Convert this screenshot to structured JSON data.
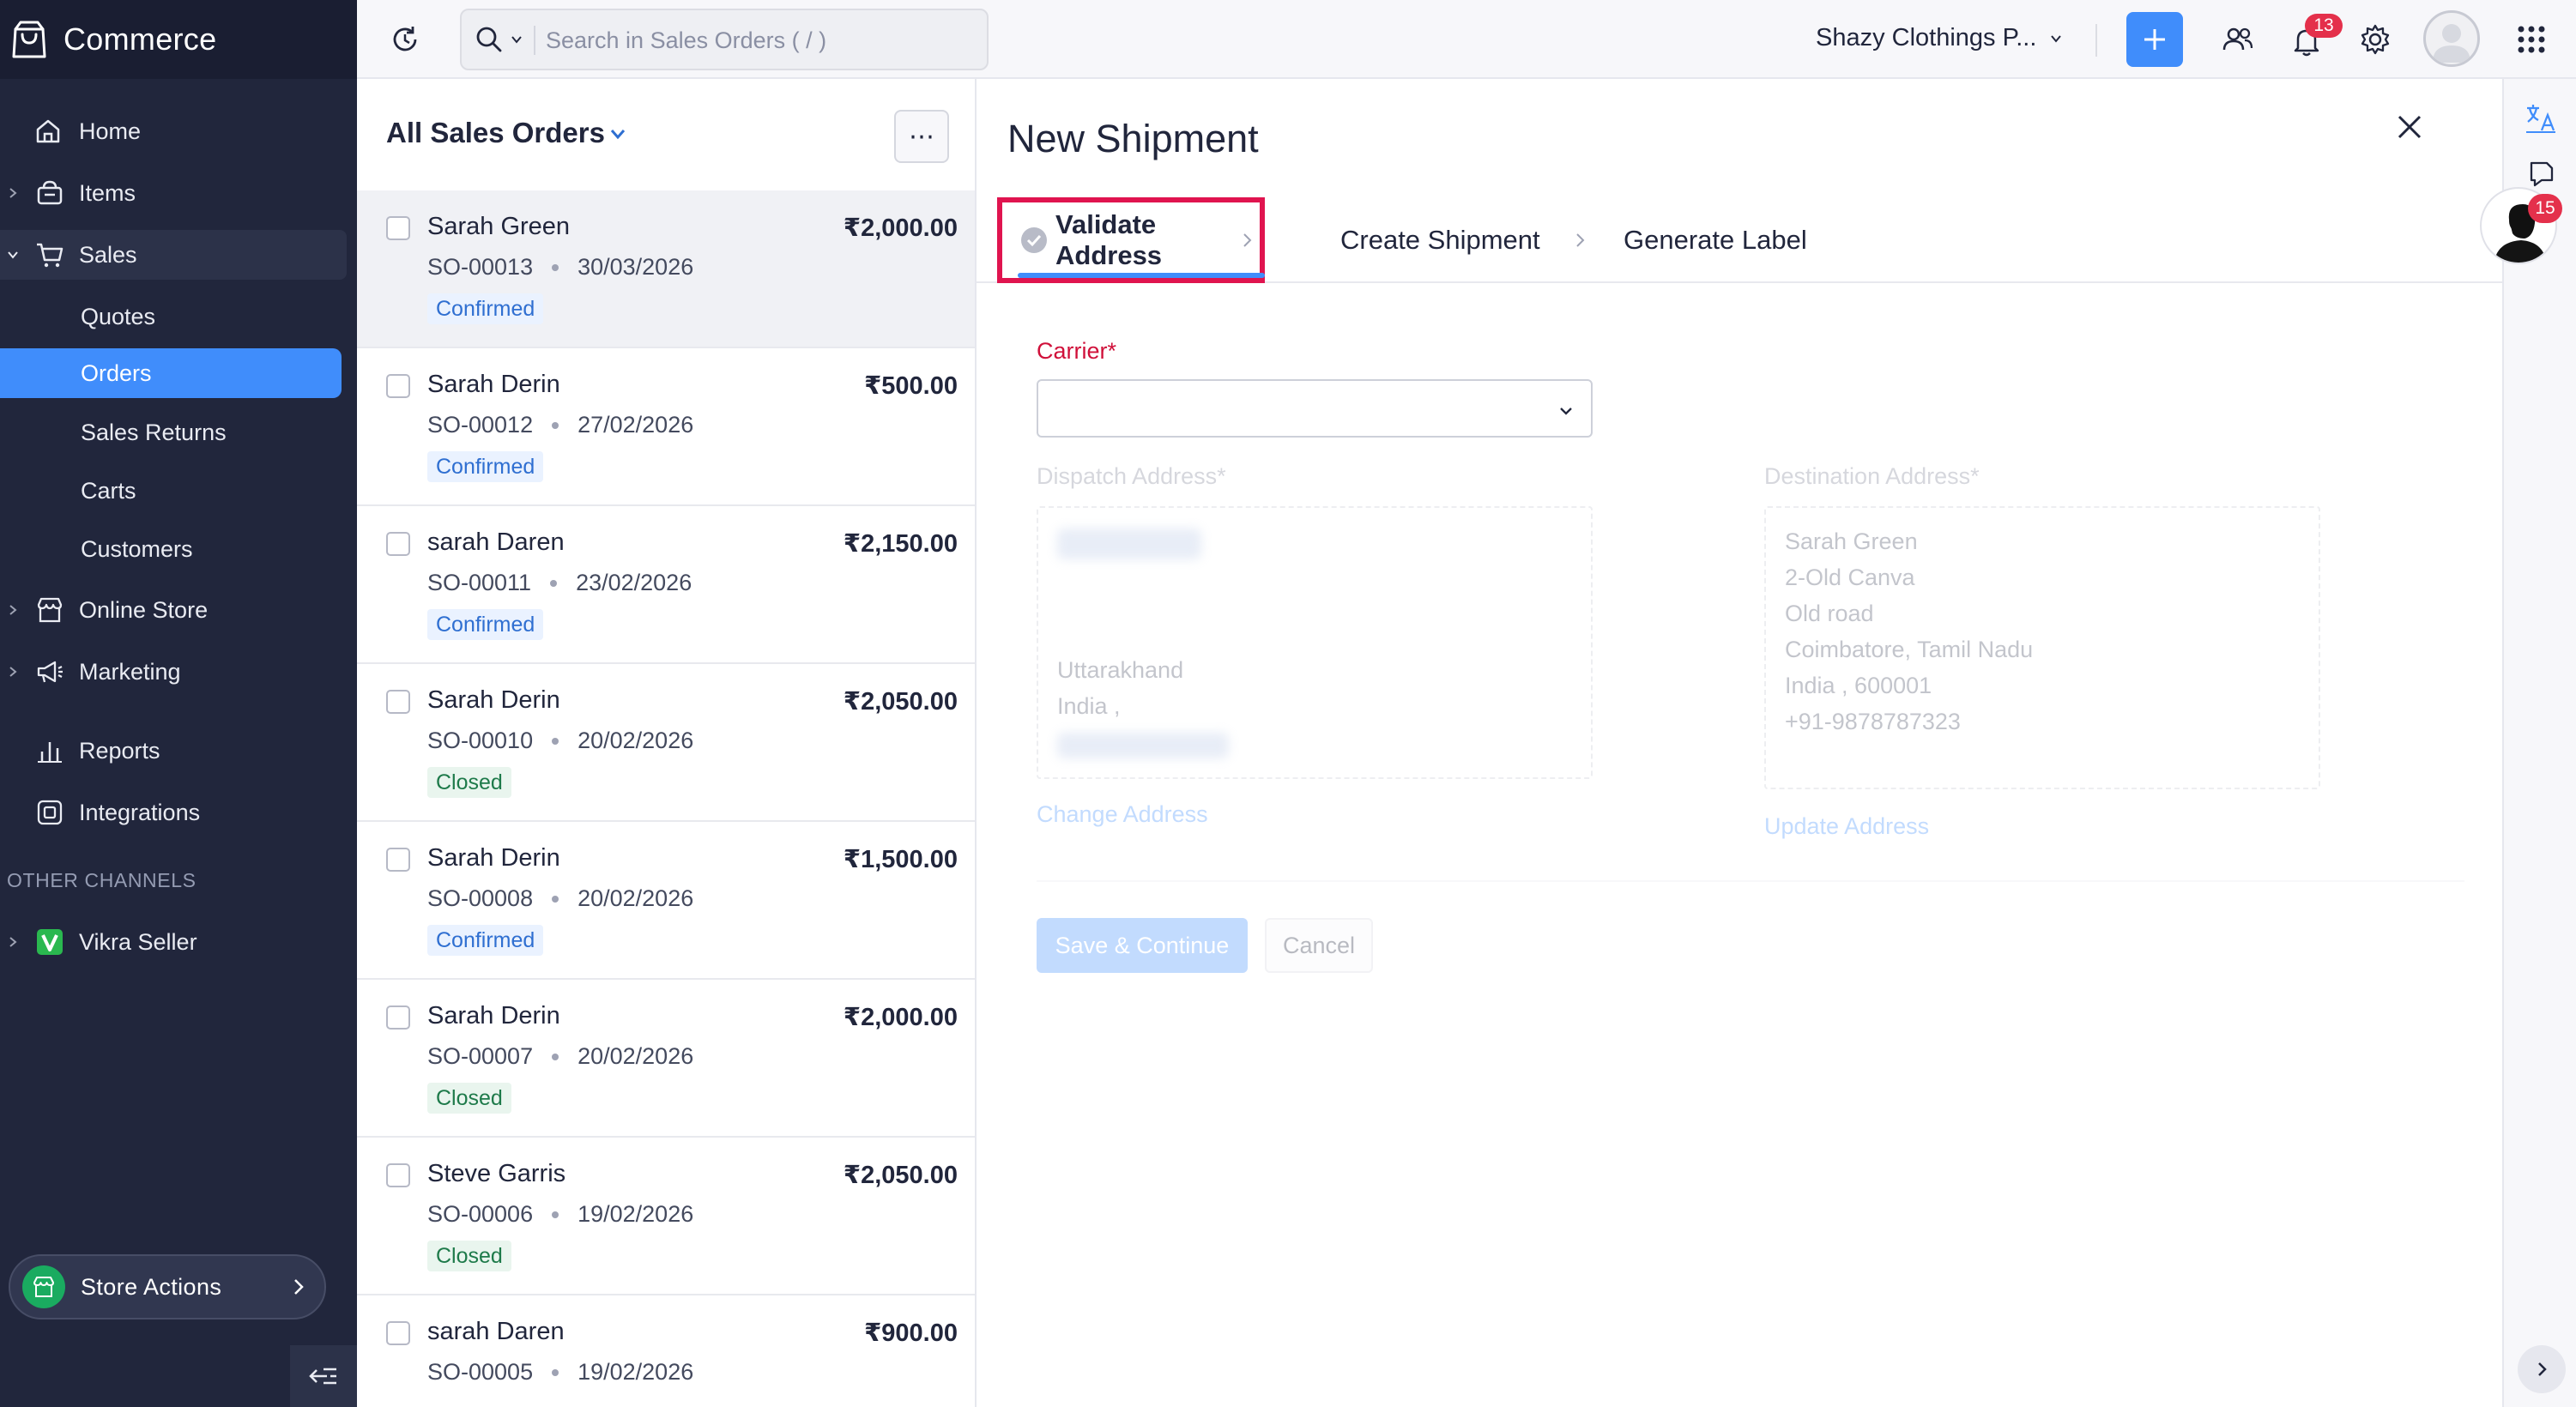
{
  "brand": {
    "name": "Commerce"
  },
  "sidebar": {
    "items": [
      {
        "label": "Home"
      },
      {
        "label": "Items"
      },
      {
        "label": "Sales"
      },
      {
        "label": "Online Store"
      },
      {
        "label": "Marketing"
      },
      {
        "label": "Reports"
      },
      {
        "label": "Integrations"
      }
    ],
    "sales_sub": [
      {
        "label": "Quotes"
      },
      {
        "label": "Orders"
      },
      {
        "label": "Sales Returns"
      },
      {
        "label": "Carts"
      },
      {
        "label": "Customers"
      }
    ],
    "other_channels_title": "OTHER CHANNELS",
    "other_channels": [
      {
        "label": "Vikra Seller"
      }
    ],
    "store_actions_label": "Store Actions"
  },
  "header": {
    "search_placeholder": "Search in Sales Orders ( / )",
    "org_name": "Shazy Clothings P...",
    "notification_count": "13"
  },
  "orders_list": {
    "title": "All Sales Orders",
    "more_label": "⋯",
    "rows": [
      {
        "customer": "Sarah Green",
        "amount": "₹2,000.00",
        "order_no": "SO-00013",
        "date": "30/03/2026",
        "status": "Confirmed"
      },
      {
        "customer": "Sarah Derin",
        "amount": "₹500.00",
        "order_no": "SO-00012",
        "date": "27/02/2026",
        "status": "Confirmed"
      },
      {
        "customer": "sarah Daren",
        "amount": "₹2,150.00",
        "order_no": "SO-00011",
        "date": "23/02/2026",
        "status": "Confirmed"
      },
      {
        "customer": "Sarah Derin",
        "amount": "₹2,050.00",
        "order_no": "SO-00010",
        "date": "20/02/2026",
        "status": "Closed"
      },
      {
        "customer": "Sarah Derin",
        "amount": "₹1,500.00",
        "order_no": "SO-00008",
        "date": "20/02/2026",
        "status": "Confirmed"
      },
      {
        "customer": "Sarah Derin",
        "amount": "₹2,000.00",
        "order_no": "SO-00007",
        "date": "20/02/2026",
        "status": "Closed"
      },
      {
        "customer": "Steve Garris",
        "amount": "₹2,050.00",
        "order_no": "SO-00006",
        "date": "19/02/2026",
        "status": "Closed"
      },
      {
        "customer": "sarah Daren",
        "amount": "₹900.00",
        "order_no": "SO-00005",
        "date": "19/02/2026",
        "status": ""
      }
    ]
  },
  "shipment": {
    "title": "New Shipment",
    "steps": [
      {
        "label": "Validate Address"
      },
      {
        "label": "Create Shipment"
      },
      {
        "label": "Generate Label"
      }
    ],
    "carrier_label": "Carrier*",
    "carrier_value": "",
    "dispatch_label": "Dispatch Address*",
    "dispatch_lines": [
      "Uttarakhand",
      "India ,"
    ],
    "change_address_label": "Change Address",
    "destination_label": "Destination Address*",
    "destination_lines": [
      "Sarah Green",
      "2-Old Canva",
      "Old road",
      "Coimbatore, Tamil Nadu",
      "India , 600001",
      "+91-9878787323"
    ],
    "update_address_label": "Update Address",
    "save_label": "Save & Continue",
    "cancel_label": "Cancel"
  },
  "right_rail": {
    "badge_count": "15"
  },
  "colors": {
    "sidebar_bg": "#21263c",
    "accent": "#408dfb",
    "highlight_border": "#e0144f",
    "required_red": "#d0103a",
    "confirmed_text": "#2f6fd1",
    "closed_text": "#1e7a4a",
    "badge_red": "#e4304b"
  }
}
